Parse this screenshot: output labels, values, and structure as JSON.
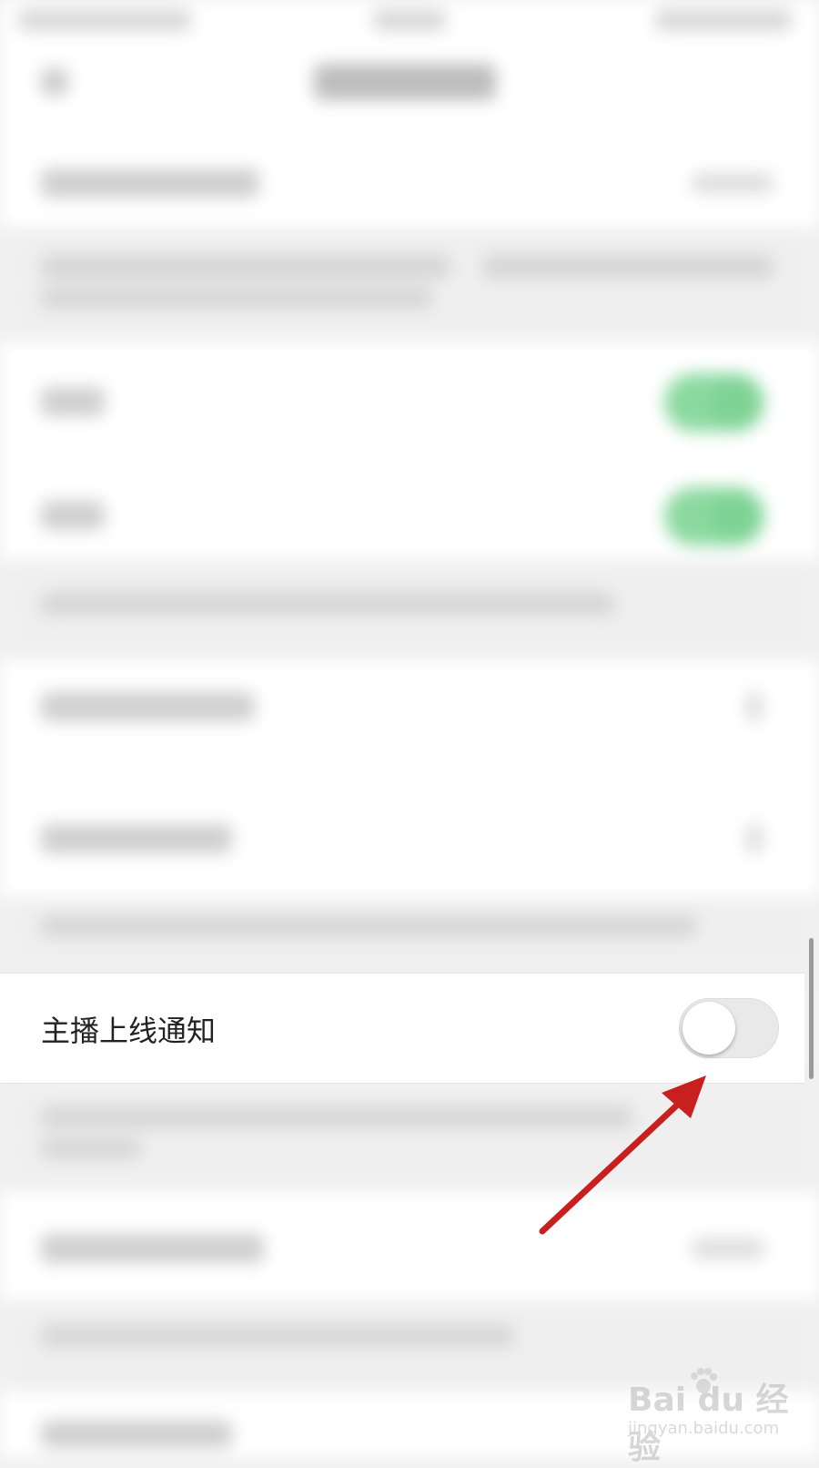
{
  "setting": {
    "label": "主播上线通知",
    "enabled": false
  },
  "watermark": {
    "logo": "Bai du 经验",
    "url": "jingyan.baidu.com"
  },
  "colors": {
    "arrow": "#c8201e",
    "toggle_on": "#8bd9a0",
    "toggle_off": "#e9e9ea"
  }
}
